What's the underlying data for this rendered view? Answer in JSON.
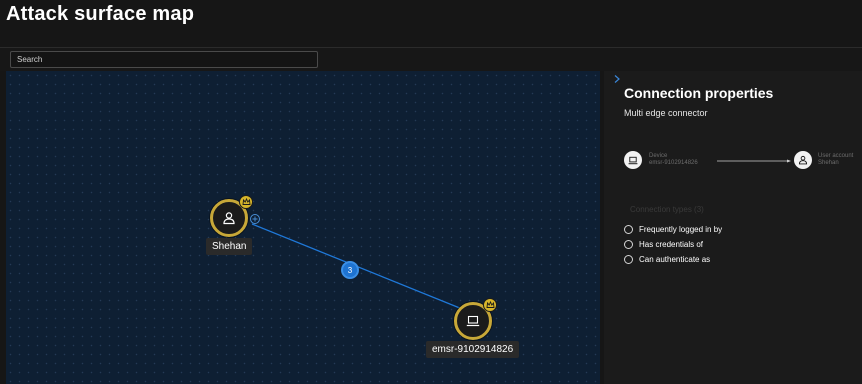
{
  "page": {
    "title": "Attack surface map"
  },
  "search": {
    "placeholder": "Search"
  },
  "map": {
    "nodes": [
      {
        "id": "user",
        "label": "Shehan",
        "icon": "user-icon",
        "badge": "crown-icon"
      },
      {
        "id": "device",
        "label": "emsr-9102914826",
        "icon": "laptop-icon",
        "badge": "crown-icon"
      }
    ],
    "edge": {
      "from": "user",
      "to": "device",
      "count": "3"
    }
  },
  "panel": {
    "title": "Connection properties",
    "subtitle": "Multi edge connector",
    "source": {
      "label": "Device",
      "name": "emsr-9102914826",
      "icon": "laptop-icon"
    },
    "target": {
      "label": "User account",
      "name": "Shehan",
      "icon": "user-icon"
    },
    "connection_types_header": "Connection types (3)",
    "connection_types": [
      "Frequently logged in by",
      "Has credentials of",
      "Can authenticate as"
    ]
  },
  "colors": {
    "accent": "#1e73d1",
    "crown": "#d6b52a",
    "node_ring": "#c8a838",
    "canvas": "#0e1f33"
  }
}
